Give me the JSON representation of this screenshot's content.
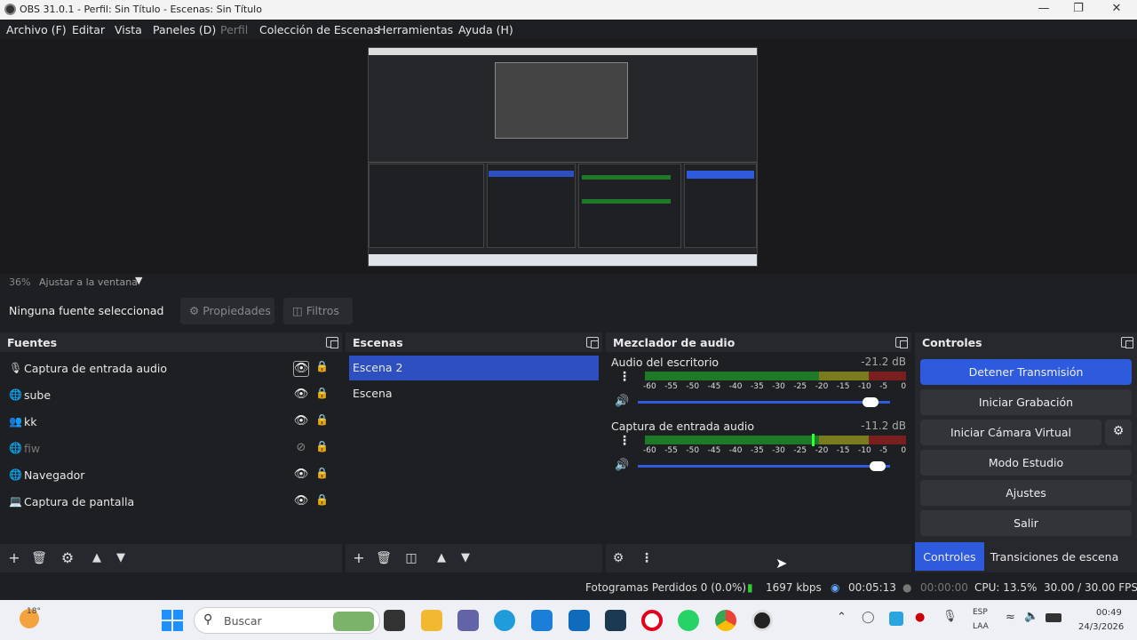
{
  "window": {
    "title": "OBS 31.0.1 - Perfil: Sin Título - Escenas: Sin Título"
  },
  "menu": [
    "Archivo (F)",
    "Editar",
    "Vista",
    "Paneles (D)",
    "Perfil",
    "Colección de Escenas",
    "Herramientas",
    "Ayuda (H)"
  ],
  "zoom": {
    "percent": "36%",
    "fit": "Ajustar a la ventana"
  },
  "source_toolbar": {
    "no_source": "Ninguna fuente seleccionad",
    "properties": "Propiedades",
    "filters": "Filtros"
  },
  "sources": {
    "title": "Fuentes",
    "items": [
      {
        "label": "Captura de entrada audio",
        "icon": "microphone-icon"
      },
      {
        "label": "sube",
        "icon": "globe-icon"
      },
      {
        "label": "kk",
        "icon": "group-icon"
      },
      {
        "label": "fiw",
        "icon": "globe-icon"
      },
      {
        "label": "Navegador",
        "icon": "globe-icon"
      },
      {
        "label": "Captura de pantalla",
        "icon": "monitor-icon"
      }
    ]
  },
  "scenes": {
    "title": "Escenas",
    "items": [
      "Escena 2",
      "Escena"
    ]
  },
  "mixer": {
    "title": "Mezclador de audio",
    "tracks": [
      {
        "name": "Audio del escritorio",
        "db": "-21.2 dB",
        "volume": 0.97
      },
      {
        "name": "Captura de entrada audio",
        "db": "-11.2 dB",
        "volume": 1.0
      }
    ],
    "ticks": [
      "-60",
      "-55",
      "-50",
      "-45",
      "-40",
      "-35",
      "-30",
      "-25",
      "-20",
      "-15",
      "-10",
      "-5",
      "0"
    ]
  },
  "controls": {
    "title": "Controles",
    "stop_stream": "Detener Transmisión",
    "start_recording": "Iniciar Grabación",
    "virtual_cam": "Iniciar Cámara Virtual",
    "studio_mode": "Modo Estudio",
    "settings": "Ajustes",
    "exit": "Salir",
    "tab_controls": "Controles",
    "tab_transitions": "Transiciones de escena"
  },
  "status": {
    "dropped": "Fotogramas Perdidos 0 (0.0%)",
    "kbps": "1697 kbps",
    "stream_time": "00:05:13",
    "rec_time": "00:00:00",
    "cpu": "CPU: 13.5%",
    "fps": "30.00 / 30.00 FPS"
  },
  "taskbar": {
    "weather": "18°",
    "search": "Buscar",
    "lang1": "ESP",
    "lang2": "LAA",
    "time": "00:49",
    "date": "24/3/2026"
  },
  "colors": {
    "accent": "#2e5bde",
    "selected_scene": "#2d4fc0",
    "meter_green": "#1f7a27",
    "meter_yellow": "#7a7a1f",
    "meter_red": "#7a1f1f"
  }
}
